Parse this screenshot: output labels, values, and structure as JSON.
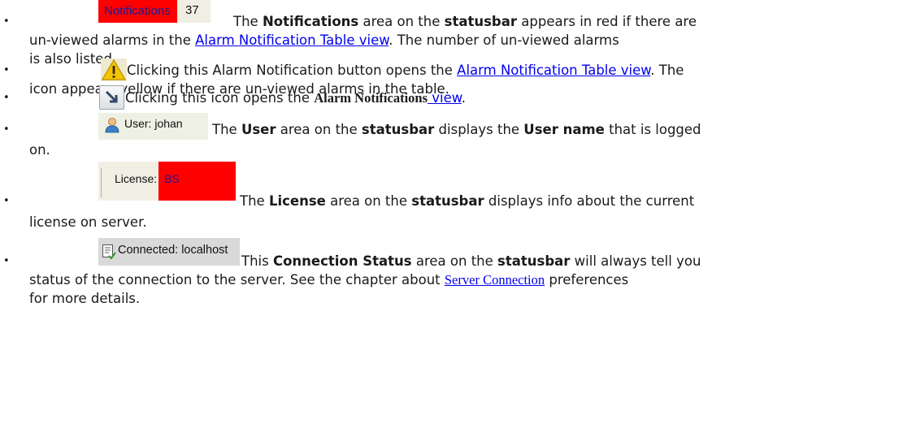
{
  "bullet": "•",
  "items": {
    "notifications": {
      "img_label": "Notifications",
      "img_count": "37",
      "t1": "The ",
      "b1": "Notifications",
      "t2": " area on the ",
      "b2": "statusbar",
      "t3": " appears in red if there are",
      "l2a": "un-viewed alarms in the ",
      "link": "Alarm Notification Table view",
      "l2b": ". The number of un-viewed alarms",
      "l3": "is also listed."
    },
    "alarm_button": {
      "t1": " Clicking this Alarm Notification button opens the ",
      "link": "Alarm Notification Table view",
      "t2": ". The",
      "l2": "icon appears yellow if there are un-viewed alarms in the table."
    },
    "alarm_view": {
      "t1": " Clicking this icon opens the ",
      "b1": "Alarm Notifications",
      "link": " view",
      "t2": "."
    },
    "user": {
      "img_label": "User: johan",
      "t1": "The ",
      "b1": "User",
      "t2": " area on the ",
      "b2": "statusbar",
      "t3": " displays the ",
      "b3": "User name",
      "t4": " that is logged",
      "l2": "on."
    },
    "license": {
      "img_label": "License:",
      "img_value": "BS",
      "t1": "The ",
      "b1": "License",
      "t2": " area on the ",
      "b2": "statusbar",
      "t3": " displays info about the current",
      "l2": "license on server."
    },
    "connection": {
      "img_label": "Connected: localhost",
      "t1": "This ",
      "b1": "Connection Status",
      "t2": " area on the ",
      "b2": "statusbar",
      "t3": " will always tell you",
      "l2a": "status of the connection to the server. See the chapter about ",
      "link": "Server Connection",
      "l2b": " preferences",
      "l3": "for more details."
    }
  },
  "colors": {
    "alert_red": "#ff0000",
    "link": "#0000ee",
    "warning_yellow": "#f5c400"
  }
}
